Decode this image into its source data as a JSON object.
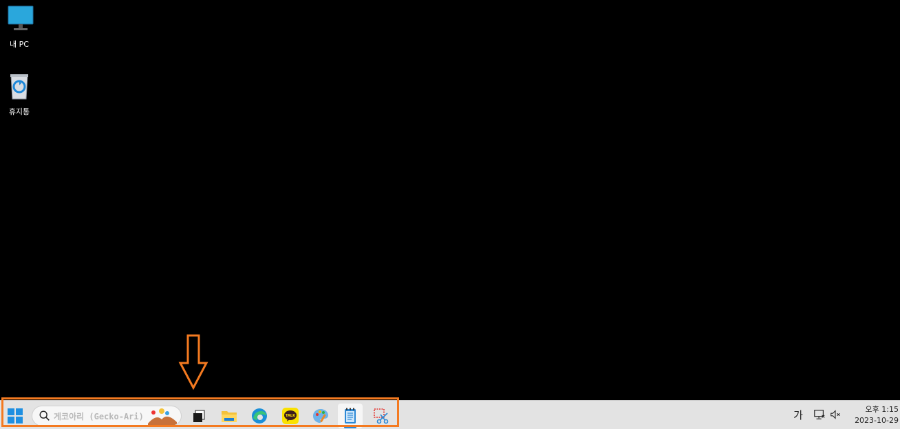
{
  "desktop": {
    "icons": [
      {
        "label": "내 PC",
        "icon": "monitor-icon"
      },
      {
        "label": "휴지통",
        "icon": "recycle-bin-icon"
      }
    ]
  },
  "taskbar": {
    "search_placeholder": "게코아리 (Gecko-Ari)",
    "apps": [
      {
        "name": "start",
        "icon": "windows-logo-icon"
      },
      {
        "name": "task-view",
        "icon": "task-view-icon"
      },
      {
        "name": "file-explorer",
        "icon": "folder-icon"
      },
      {
        "name": "edge",
        "icon": "edge-browser-icon"
      },
      {
        "name": "kakaotalk",
        "icon": "kakaotalk-icon"
      },
      {
        "name": "paint",
        "icon": "paint-palette-icon"
      },
      {
        "name": "notepad",
        "icon": "notepad-icon"
      },
      {
        "name": "snipping-tool",
        "icon": "scissors-icon"
      }
    ],
    "tray": {
      "ime": "가",
      "clock_ampm_time": "오후 1:15",
      "date": "2023-10-29"
    }
  },
  "annotation": {
    "highlight_color": "#f47a20"
  }
}
